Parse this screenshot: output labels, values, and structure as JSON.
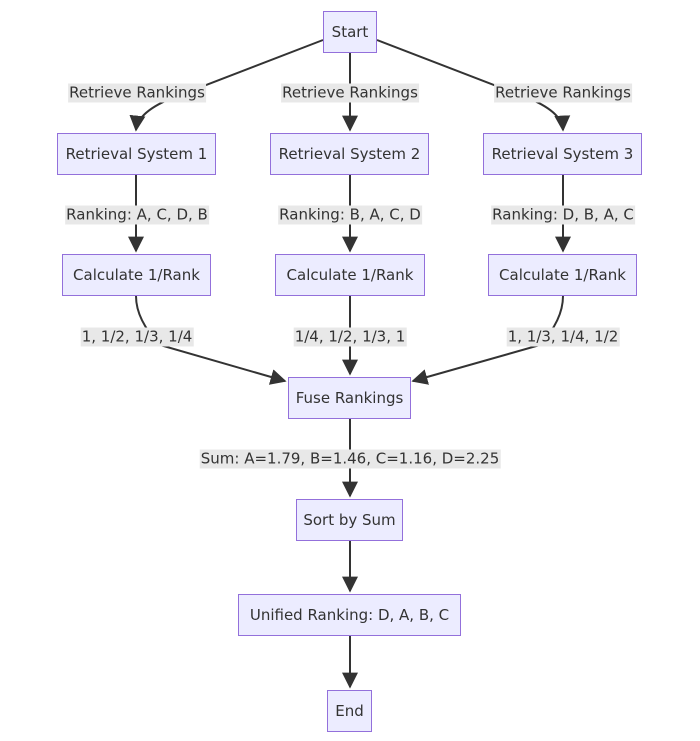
{
  "diagram": {
    "type": "flowchart",
    "colors": {
      "node_fill": "#ececff",
      "node_border": "#9370db",
      "edge": "#333333",
      "label_bg": "#e8e8e8"
    },
    "nodes": {
      "start": "Start",
      "rs1": "Retrieval System 1",
      "rs2": "Retrieval System 2",
      "rs3": "Retrieval System 3",
      "calc1": "Calculate 1/Rank",
      "calc2": "Calculate 1/Rank",
      "calc3": "Calculate 1/Rank",
      "fuse": "Fuse Rankings",
      "sort": "Sort by Sum",
      "unified": "Unified Ranking: D, A, B, C",
      "end": "End"
    },
    "edges": [
      {
        "from": "start",
        "to": "rs1",
        "label": "Retrieve Rankings"
      },
      {
        "from": "start",
        "to": "rs2",
        "label": "Retrieve Rankings"
      },
      {
        "from": "start",
        "to": "rs3",
        "label": "Retrieve Rankings"
      },
      {
        "from": "rs1",
        "to": "calc1",
        "label": "Ranking: A, C, D, B"
      },
      {
        "from": "rs2",
        "to": "calc2",
        "label": "Ranking: B, A, C, D"
      },
      {
        "from": "rs3",
        "to": "calc3",
        "label": "Ranking: D, B, A, C"
      },
      {
        "from": "calc1",
        "to": "fuse",
        "label": "1, 1/2, 1/3, 1/4"
      },
      {
        "from": "calc2",
        "to": "fuse",
        "label": "1/4, 1/2, 1/3, 1"
      },
      {
        "from": "calc3",
        "to": "fuse",
        "label": "1, 1/3, 1/4, 1/2"
      },
      {
        "from": "fuse",
        "to": "sort",
        "label": "Sum: A=1.79, B=1.46, C=1.16, D=2.25"
      },
      {
        "from": "sort",
        "to": "unified",
        "label": ""
      },
      {
        "from": "unified",
        "to": "end",
        "label": ""
      }
    ]
  }
}
